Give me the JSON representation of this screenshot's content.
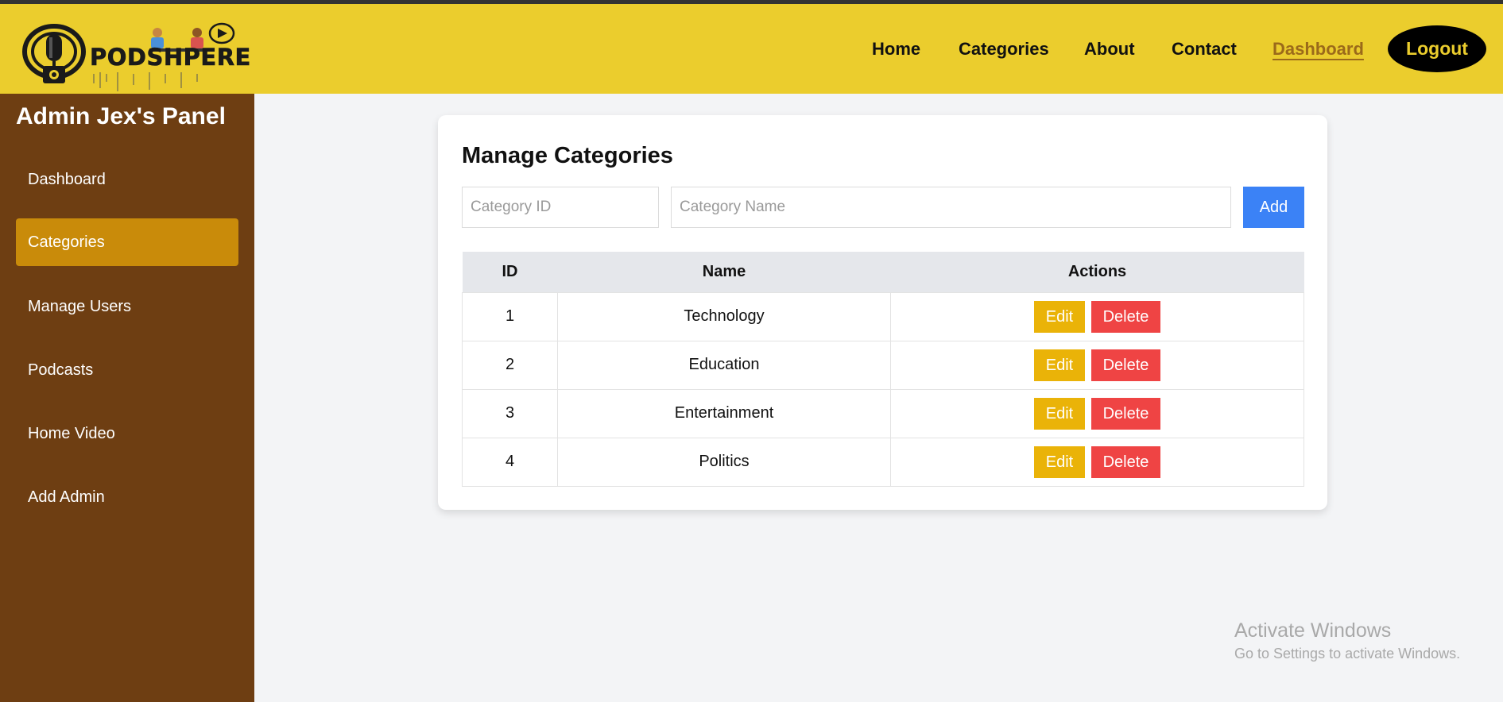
{
  "header": {
    "brand": "PODSHPERE",
    "nav": [
      {
        "label": "Home"
      },
      {
        "label": "Categories"
      },
      {
        "label": "About"
      },
      {
        "label": "Contact"
      },
      {
        "label": "Dashboard",
        "active": true
      }
    ],
    "logout_label": "Logout",
    "colors": {
      "bar": "#ebcd2d",
      "active_link": "#9b6a1a",
      "logout_bg": "#000000"
    }
  },
  "sidebar": {
    "title": "Admin Jex's Panel",
    "items": [
      {
        "label": "Dashboard"
      },
      {
        "label": "Categories",
        "active": true
      },
      {
        "label": "Manage Users"
      },
      {
        "label": "Podcasts"
      },
      {
        "label": "Home Video"
      },
      {
        "label": "Add Admin"
      }
    ],
    "colors": {
      "background": "#6e3e12",
      "active": "#c98b0a"
    }
  },
  "main": {
    "title": "Manage Categories",
    "form": {
      "id_placeholder": "Category ID",
      "id_value": "",
      "name_placeholder": "Category Name",
      "name_value": "",
      "add_label": "Add"
    },
    "table": {
      "headers": [
        "ID",
        "Name",
        "Actions"
      ],
      "rows": [
        {
          "id": "1",
          "name": "Technology",
          "edit": "Edit",
          "delete": "Delete"
        },
        {
          "id": "2",
          "name": "Education",
          "edit": "Edit",
          "delete": "Delete"
        },
        {
          "id": "3",
          "name": "Entertainment",
          "edit": "Edit",
          "delete": "Delete"
        },
        {
          "id": "4",
          "name": "Politics",
          "edit": "Edit",
          "delete": "Delete"
        }
      ]
    }
  },
  "watermark": {
    "title": "Activate Windows",
    "subtitle": "Go to Settings to activate Windows."
  },
  "icons": {
    "logo": "microphone-icon",
    "play": "play-icon"
  }
}
